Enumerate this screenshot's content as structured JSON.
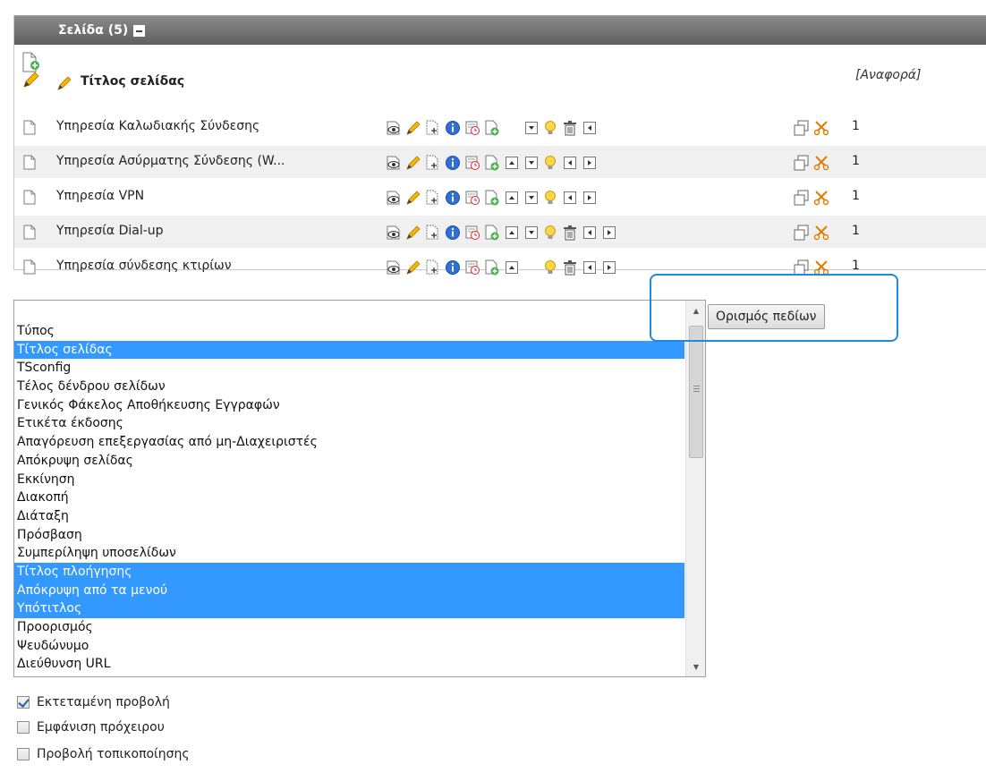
{
  "panel": {
    "header_title": "Σελίδα (5)",
    "column_title": "Τίτλος σελίδας",
    "column_ref": "[Αναφορά]"
  },
  "rows": [
    {
      "title": "Υπηρεσία Καλωδιακής Σύνδεσης",
      "count": "1",
      "has_up": false,
      "has_down": true,
      "has_delete": true,
      "has_right": false
    },
    {
      "title": "Υπηρεσία Ασύρματης Σύνδεσης (W...",
      "count": "1",
      "has_up": true,
      "has_down": true,
      "has_delete": false,
      "has_right": true
    },
    {
      "title": "Υπηρεσία VPN",
      "count": "1",
      "has_up": true,
      "has_down": true,
      "has_delete": false,
      "has_right": true
    },
    {
      "title": "Υπηρεσία Dial-up",
      "count": "1",
      "has_up": true,
      "has_down": true,
      "has_delete": true,
      "has_right": true
    },
    {
      "title": "Υπηρεσία σύνδεσης κτιρίων",
      "count": "1",
      "has_up": true,
      "has_down": false,
      "has_delete": true,
      "has_right": true
    }
  ],
  "fields": {
    "options": [
      {
        "label": "Τύπος",
        "selected": false
      },
      {
        "label": "Τίτλος σελίδας",
        "selected": true
      },
      {
        "label": "TSconfig",
        "selected": false
      },
      {
        "label": "Τέλος δένδρου σελίδων",
        "selected": false
      },
      {
        "label": "Γενικός Φάκελος Αποθήκευσης Εγγραφών",
        "selected": false
      },
      {
        "label": "Ετικέτα έκδοσης",
        "selected": false
      },
      {
        "label": "Απαγόρευση επεξεργασίας από μη-Διαχειριστές",
        "selected": false
      },
      {
        "label": "Απόκρυψη σελίδας",
        "selected": false
      },
      {
        "label": "Εκκίνηση",
        "selected": false
      },
      {
        "label": "Διακοπή",
        "selected": false
      },
      {
        "label": "Διάταξη",
        "selected": false
      },
      {
        "label": "Πρόσβαση",
        "selected": false
      },
      {
        "label": "Συμπερίληψη υποσελίδων",
        "selected": false
      },
      {
        "label": "Τίτλος πλοήγησης",
        "selected": true
      },
      {
        "label": "Απόκρυψη από τα μενού",
        "selected": true
      },
      {
        "label": "Υπότιτλος",
        "selected": true
      },
      {
        "label": "Προορισμός",
        "selected": false
      },
      {
        "label": "Ψευδώνυμο",
        "selected": false
      },
      {
        "label": "Διεύθυνση URL",
        "selected": false
      }
    ],
    "define_button": "Ορισμός πεδίων"
  },
  "options": [
    {
      "label": "Εκτεταμένη προβολή",
      "checked": true
    },
    {
      "label": "Εμφάνιση πρόχειρου",
      "checked": false
    },
    {
      "label": "Προβολή τοπικοποίησης",
      "checked": false
    }
  ],
  "colors": {
    "header": "#6e6e6e",
    "selection": "#3399ff",
    "highlight": "#1e88e5"
  }
}
